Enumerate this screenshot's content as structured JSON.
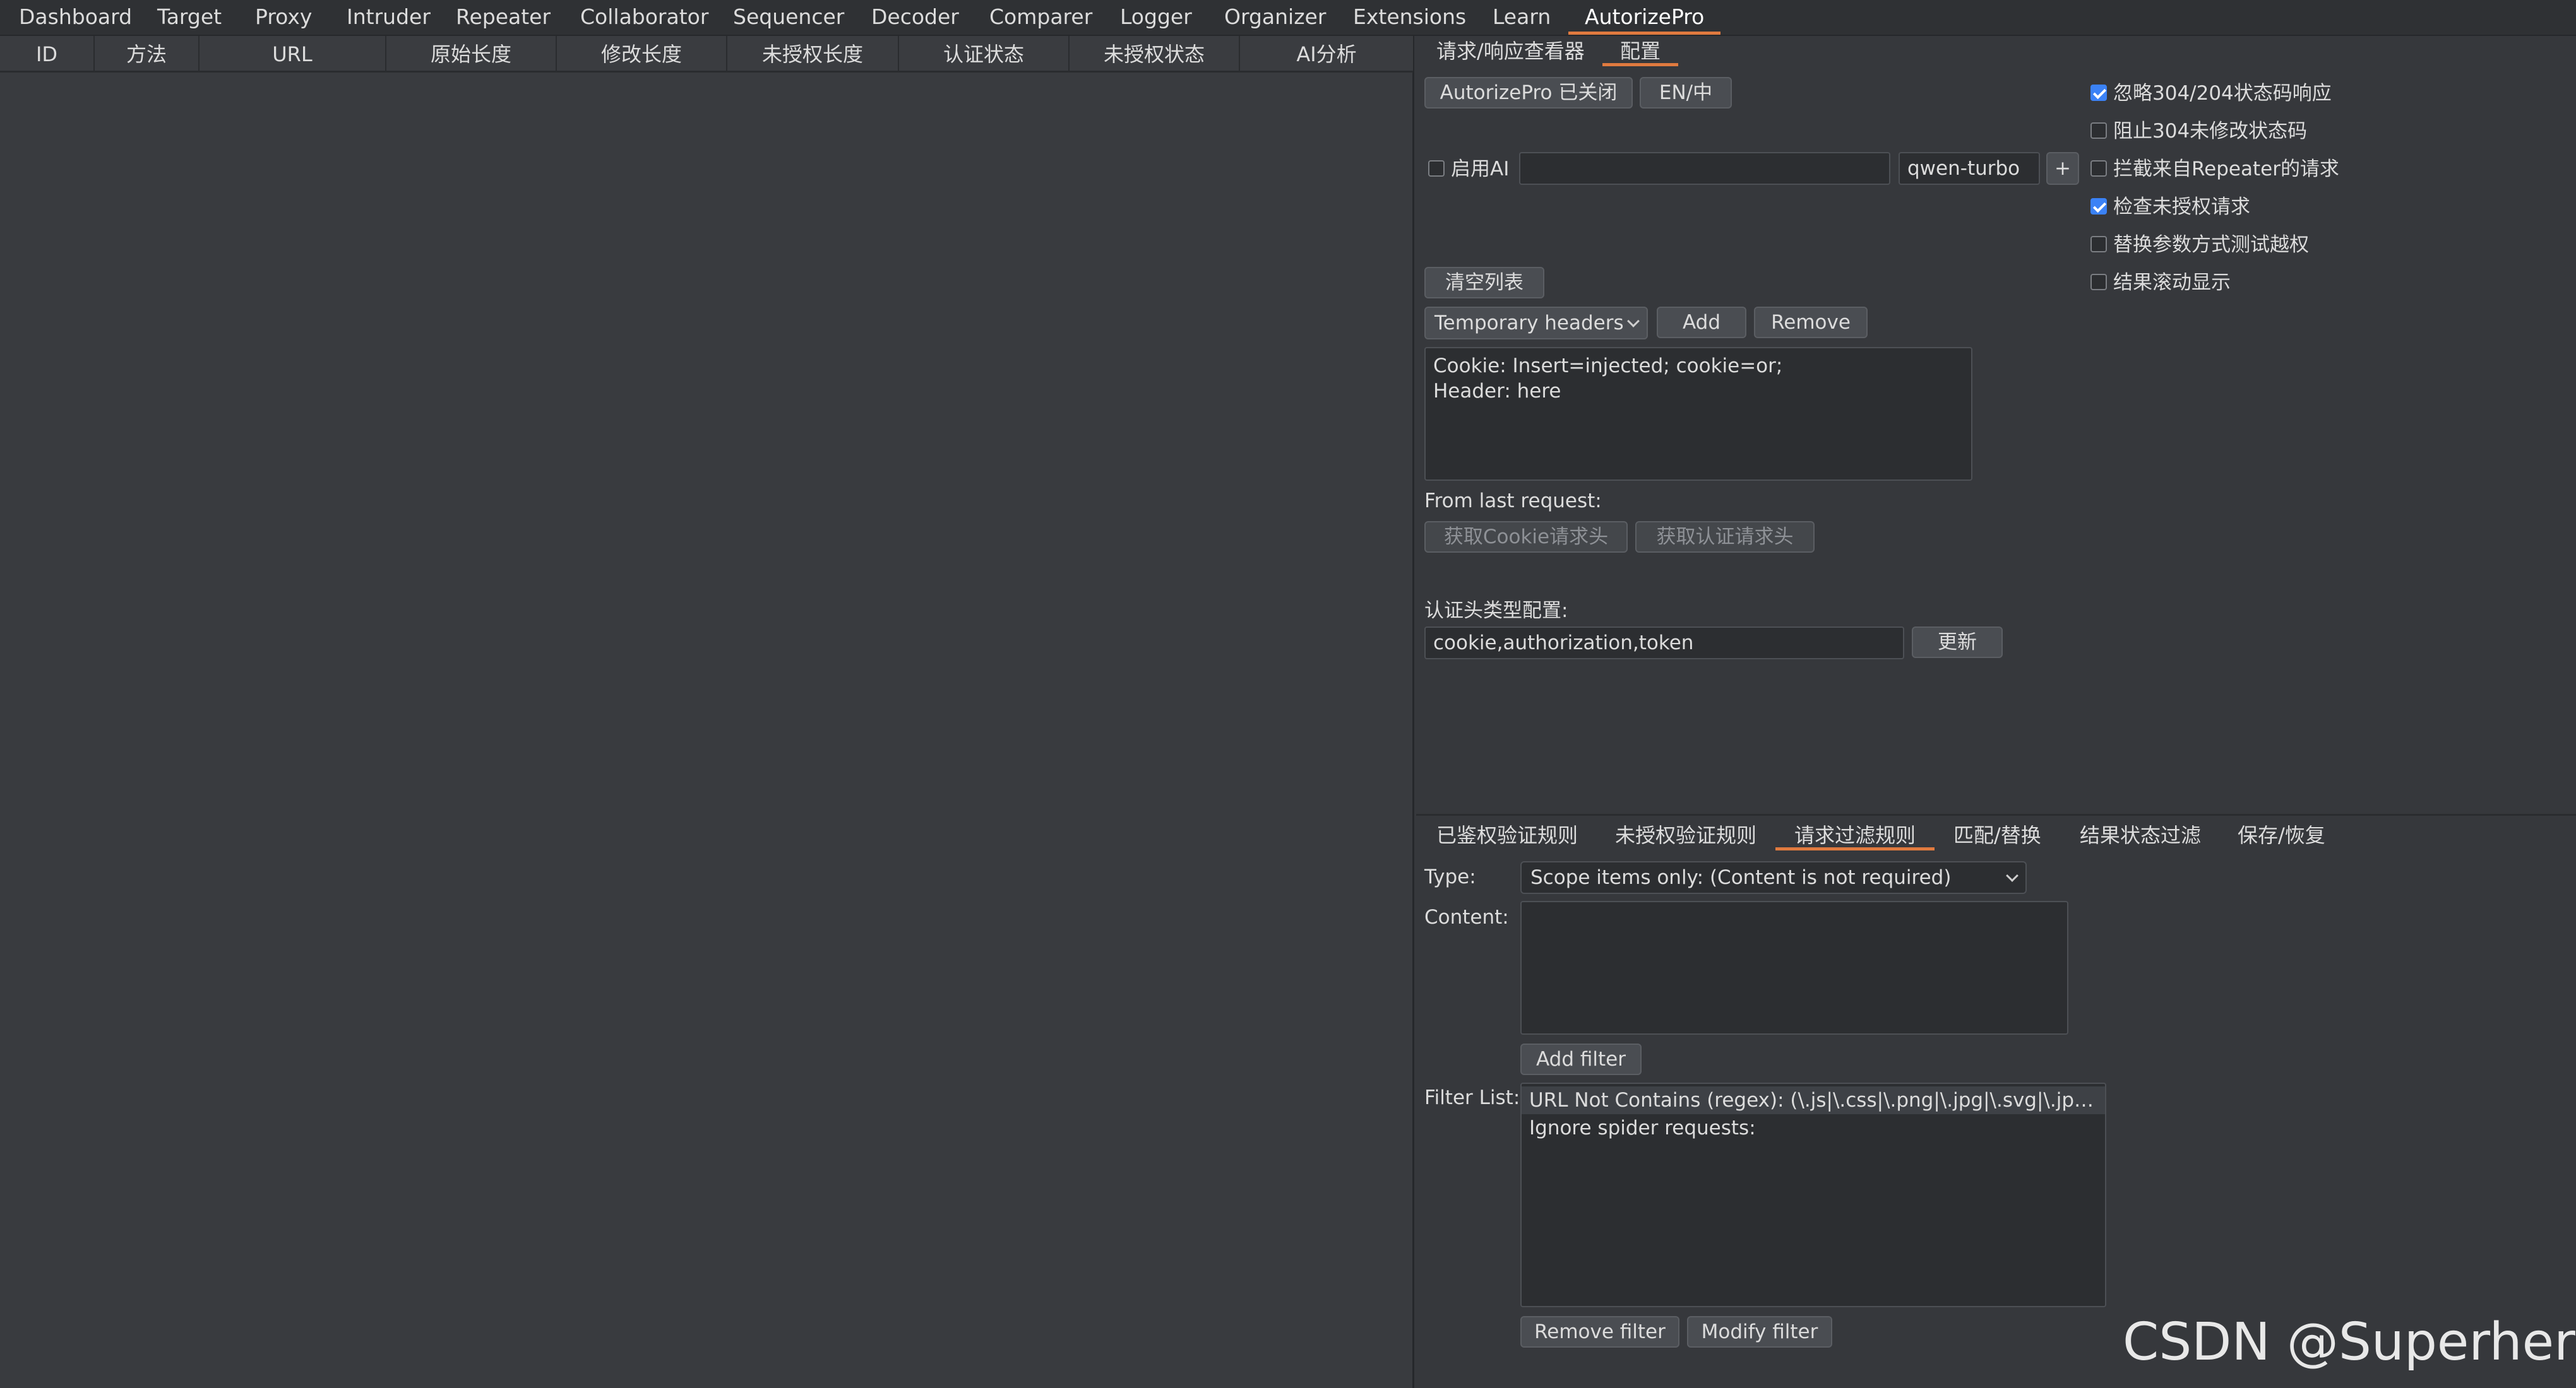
{
  "nav": {
    "tabs": [
      "Dashboard",
      "Target",
      "Proxy",
      "Intruder",
      "Repeater",
      "Collaborator",
      "Sequencer",
      "Decoder",
      "Comparer",
      "Logger",
      "Organizer",
      "Extensions",
      "Learn",
      "AutorizePro"
    ],
    "active": "AutorizePro"
  },
  "table": {
    "columns": [
      "ID",
      "方法",
      "URL",
      "原始长度",
      "修改长度",
      "未授权长度",
      "认证状态",
      "未授权状态",
      "AI分析"
    ]
  },
  "right_tabs": {
    "items": [
      "请求/响应查看器",
      "配置"
    ],
    "active": "配置"
  },
  "config": {
    "toggle_button": "AutorizePro 已关闭",
    "lang_button": "EN/中",
    "enable_ai_label": "启用AI",
    "enable_ai_checked": false,
    "ai_key_value": "",
    "ai_model": "qwen-turbo",
    "add_model_button": "+",
    "checkboxes": [
      {
        "label": "忽略304/204状态码响应",
        "checked": true
      },
      {
        "label": "阻止304未修改状态码",
        "checked": false
      },
      {
        "label": "拦截来自Repeater的请求",
        "checked": false
      },
      {
        "label": "检查未授权请求",
        "checked": true
      },
      {
        "label": "替换参数方式测试越权",
        "checked": false
      },
      {
        "label": "结果滚动显示",
        "checked": false
      }
    ],
    "clear_button": "清空列表",
    "headers_select": "Temporary headers",
    "add_button": "Add",
    "remove_button": "Remove",
    "headers_text": "Cookie: Insert=injected; cookie=or;\nHeader: here",
    "from_last_label": "From last request:",
    "get_cookie_button": "获取Cookie请求头",
    "get_auth_button": "获取认证请求头",
    "auth_type_label": "认证头类型配置:",
    "auth_type_value": "cookie,authorization,token",
    "update_button": "更新"
  },
  "bottom_tabs": {
    "items": [
      "已鉴权验证规则",
      "未授权验证规则",
      "请求过滤规则",
      "匹配/替换",
      "结果状态过滤",
      "保存/恢复"
    ],
    "active": "请求过滤规则"
  },
  "filter": {
    "type_label": "Type:",
    "type_value": "Scope items only: (Content is not required)",
    "content_label": "Content:",
    "content_value": "",
    "add_filter_button": "Add filter",
    "list_label": "Filter List:",
    "items": [
      "URL Not Contains (regex): (\\.js|\\.css|\\.png|\\.jpg|\\.svg|\\.jpeg|\\.gi...",
      "Ignore spider requests:"
    ],
    "remove_filter_button": "Remove filter",
    "modify_filter_button": "Modify filter"
  },
  "watermark": "CSDN @SuperherRo",
  "colors": {
    "accent": "#e07a3f",
    "checkbox_on": "#3b82f6",
    "background": "#36383c"
  }
}
